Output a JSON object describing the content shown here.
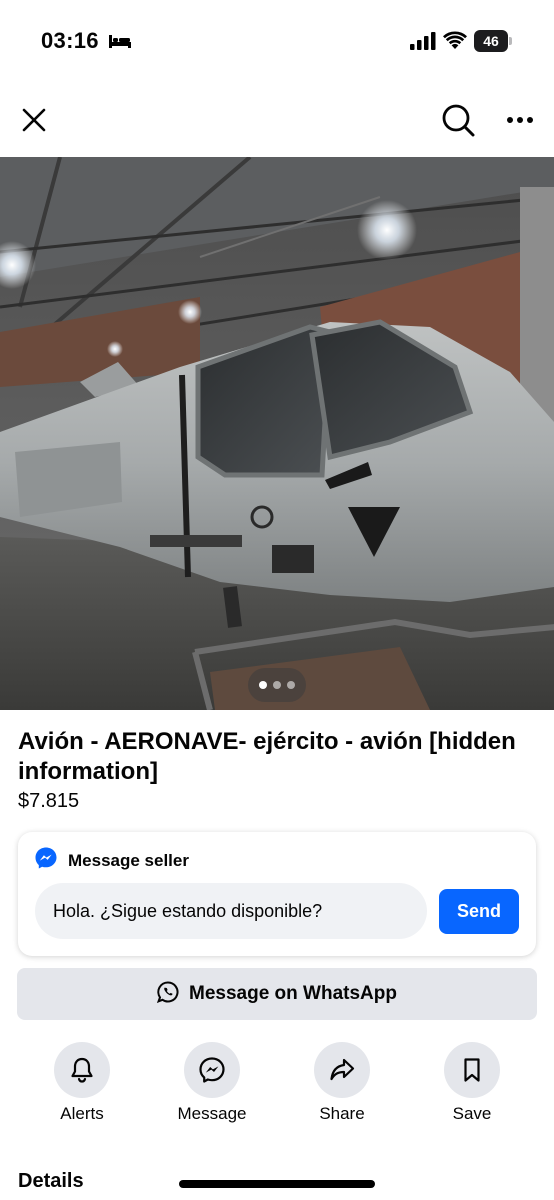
{
  "status_bar": {
    "time": "03:16",
    "battery_level": "46",
    "icons": [
      "bed-icon",
      "signal-icon",
      "wifi-icon",
      "battery-icon"
    ]
  },
  "nav": {
    "icons": [
      "close-icon",
      "search-icon",
      "more-icon"
    ]
  },
  "photo": {
    "subject": "aircraft",
    "page_count": 3,
    "current_page": 1
  },
  "listing": {
    "title": "Avión - AERONAVE- ejército - avión [hidden information]",
    "price": "$7.815"
  },
  "message_card": {
    "heading": "Message seller",
    "input_value": "Hola. ¿Sigue estando disponible?",
    "send_label": "Send"
  },
  "whatsapp": {
    "label": "Message on WhatsApp"
  },
  "actions": [
    {
      "label": "Alerts",
      "icon": "bell-icon"
    },
    {
      "label": "Message",
      "icon": "messenger-icon"
    },
    {
      "label": "Share",
      "icon": "share-icon"
    },
    {
      "label": "Save",
      "icon": "bookmark-icon"
    }
  ],
  "details": {
    "heading": "Details"
  },
  "colors": {
    "accent": "#0866ff",
    "button_gray": "#e4e6eb",
    "input_gray": "#f0f2f5",
    "text": "#050505"
  }
}
